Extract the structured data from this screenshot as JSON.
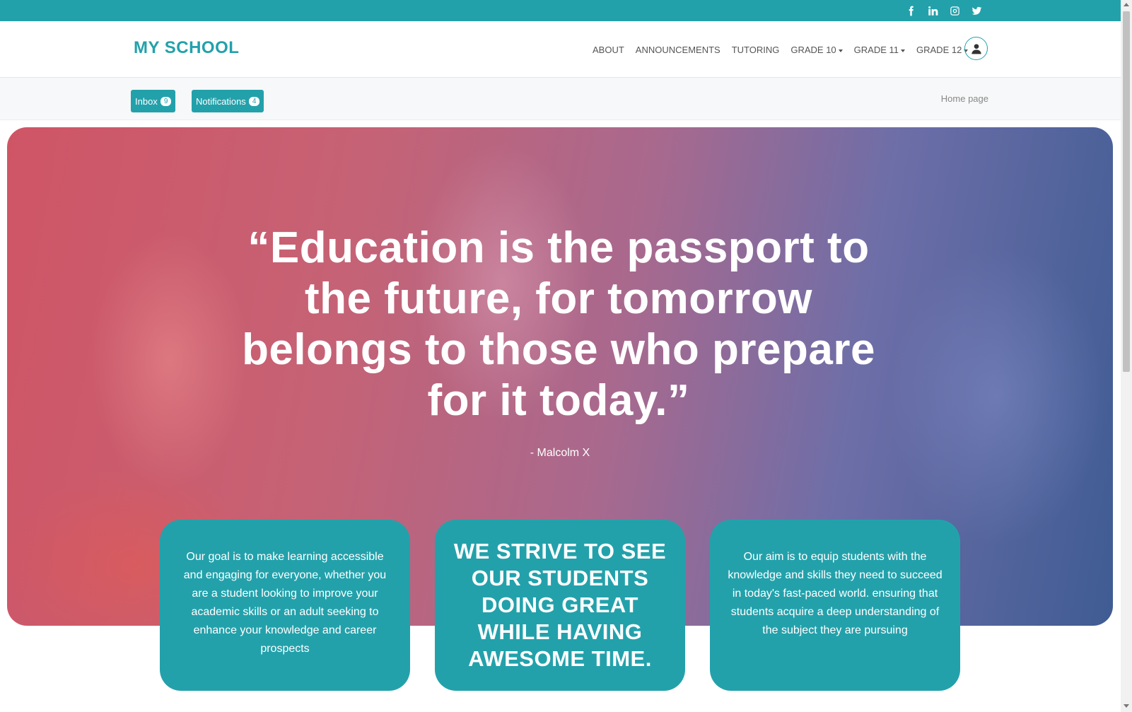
{
  "colors": {
    "accent": "#23a1ab",
    "white": "#ffffff"
  },
  "social": [
    "facebook-icon",
    "linkedin-icon",
    "instagram-icon",
    "twitter-icon"
  ],
  "header": {
    "logo": "MY SCHOOL",
    "nav": [
      {
        "label": "ABOUT"
      },
      {
        "label": "ANNOUNCEMENTS"
      },
      {
        "label": "TUTORING"
      },
      {
        "label": "GRADE 10"
      },
      {
        "label": "GRADE 11"
      },
      {
        "label": "GRADE 12"
      }
    ]
  },
  "subbar": {
    "inbox": {
      "label": "Inbox",
      "count": "9"
    },
    "notifications": {
      "label": "Notifications",
      "count": "4"
    },
    "breadcrumb": "Home page"
  },
  "hero": {
    "quote": "“Education is the passport to the future, for tomorrow belongs to those who prepare for it today.”",
    "author": "- Malcolm X"
  },
  "cards": [
    {
      "text": "Our goal is to make learning accessible and engaging for everyone, whether you are a student looking to improve your academic skills or an adult seeking to enhance your knowledge and career prospects"
    },
    {
      "text": "WE STRIVE TO SEE OUR STUDENTS DOING GREAT WHILE HAVING AWESOME TIME."
    },
    {
      "text": "Our aim is to equip students with the knowledge and skills they need to succeed in today's fast-paced world. ensuring that students acquire a deep understanding of the subject they are pursuing"
    }
  ]
}
